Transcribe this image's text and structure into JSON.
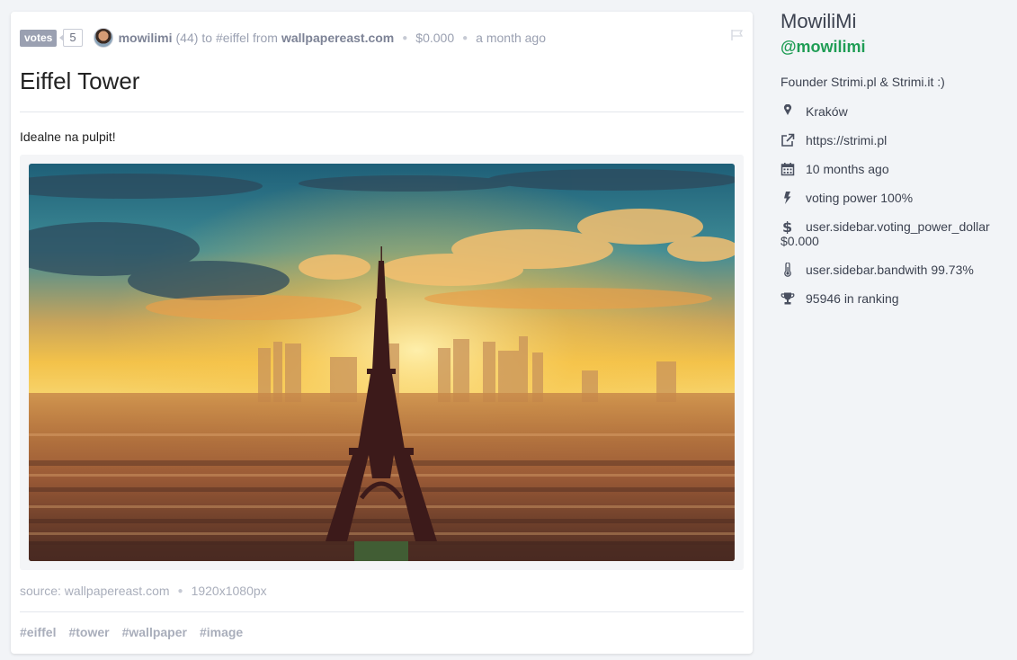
{
  "post": {
    "votes_label": "votes",
    "votes_count": "5",
    "author": "mowilimi",
    "reputation": "(44)",
    "to_text": "to #eiffel from",
    "domain": "wallpapereast.com",
    "payout": "$0.000",
    "time": "a month ago",
    "title": "Eiffel Tower",
    "body": "Idealne na pulpit!",
    "source": "source: wallpapereast.com",
    "resolution": "1920x1080px",
    "tags": [
      "#eiffel",
      "#tower",
      "#wallpaper",
      "#image"
    ]
  },
  "sidebar": {
    "name": "MowiliMi",
    "handle": "@mowilimi",
    "bio": "Founder Strimi.pl & Strimi.it :)",
    "items": [
      {
        "icon": "map-marker-icon",
        "text": "Kraków"
      },
      {
        "icon": "external-link-icon",
        "text": "https://strimi.pl"
      },
      {
        "icon": "calendar-icon",
        "text": "10 months ago"
      },
      {
        "icon": "bolt-icon",
        "text": "voting power 100%"
      },
      {
        "icon": "dollar-icon",
        "text": "user.sidebar.voting_power_dollar $0.000"
      },
      {
        "icon": "thermometer-icon",
        "text": "user.sidebar.bandwith 99.73%"
      },
      {
        "icon": "trophy-icon",
        "text": "95946 in ranking"
      }
    ]
  },
  "colors": {
    "accent_green": "#1f9d55",
    "muted": "#9aa0b1",
    "background": "#f2f4f7"
  }
}
